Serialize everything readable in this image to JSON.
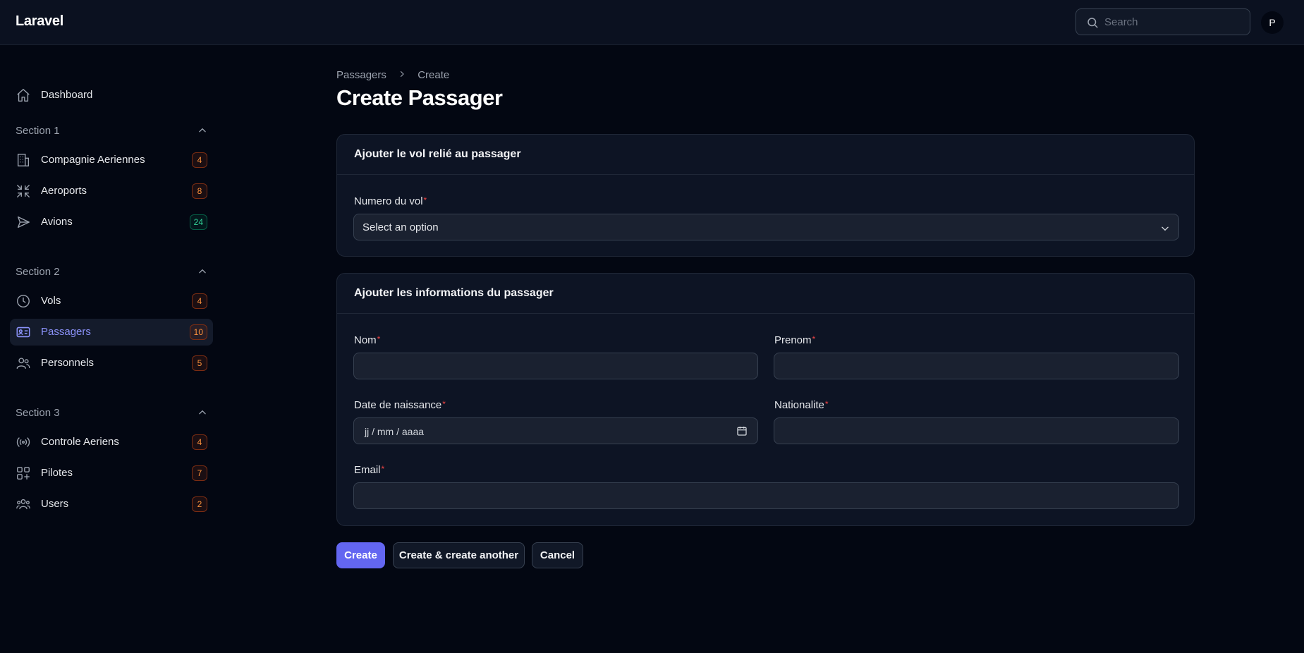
{
  "topbar": {
    "brand": "Laravel",
    "search_placeholder": "Search",
    "avatar_initial": "P"
  },
  "sidebar": {
    "dashboard": "Dashboard",
    "section1": {
      "label": "Section 1",
      "items": [
        {
          "label": "Compagnie Aeriennes",
          "count": "4"
        },
        {
          "label": "Aeroports",
          "count": "8"
        },
        {
          "label": "Avions",
          "count": "24"
        }
      ]
    },
    "section2": {
      "label": "Section 2",
      "items": [
        {
          "label": "Vols",
          "count": "4"
        },
        {
          "label": "Passagers",
          "count": "10"
        },
        {
          "label": "Personnels",
          "count": "5"
        }
      ]
    },
    "section3": {
      "label": "Section 3",
      "items": [
        {
          "label": "Controle Aeriens",
          "count": "4"
        },
        {
          "label": "Pilotes",
          "count": "7"
        },
        {
          "label": "Users",
          "count": "2"
        }
      ]
    }
  },
  "breadcrumb": [
    "Passagers",
    "Create"
  ],
  "page_title": "Create Passager",
  "card1": {
    "title": "Ajouter le vol relié au passager",
    "flight_label": "Numero du vol",
    "flight_value": "Select an option"
  },
  "card2": {
    "title": "Ajouter les informations du passager",
    "nom_label": "Nom",
    "prenom_label": "Prenom",
    "dob_label": "Date de naissance",
    "dob_placeholder": "jj / mm / aaaa",
    "nationalite_label": "Nationalite",
    "email_label": "Email"
  },
  "required_mark": "*",
  "buttons": {
    "create": "Create",
    "create_another": "Create & create another",
    "cancel": "Cancel"
  },
  "colors": {
    "background": "#030712",
    "accent": "#6366f1",
    "badge_warning": "#fb923c",
    "badge_success": "#34d399",
    "required": "#ef4444"
  }
}
